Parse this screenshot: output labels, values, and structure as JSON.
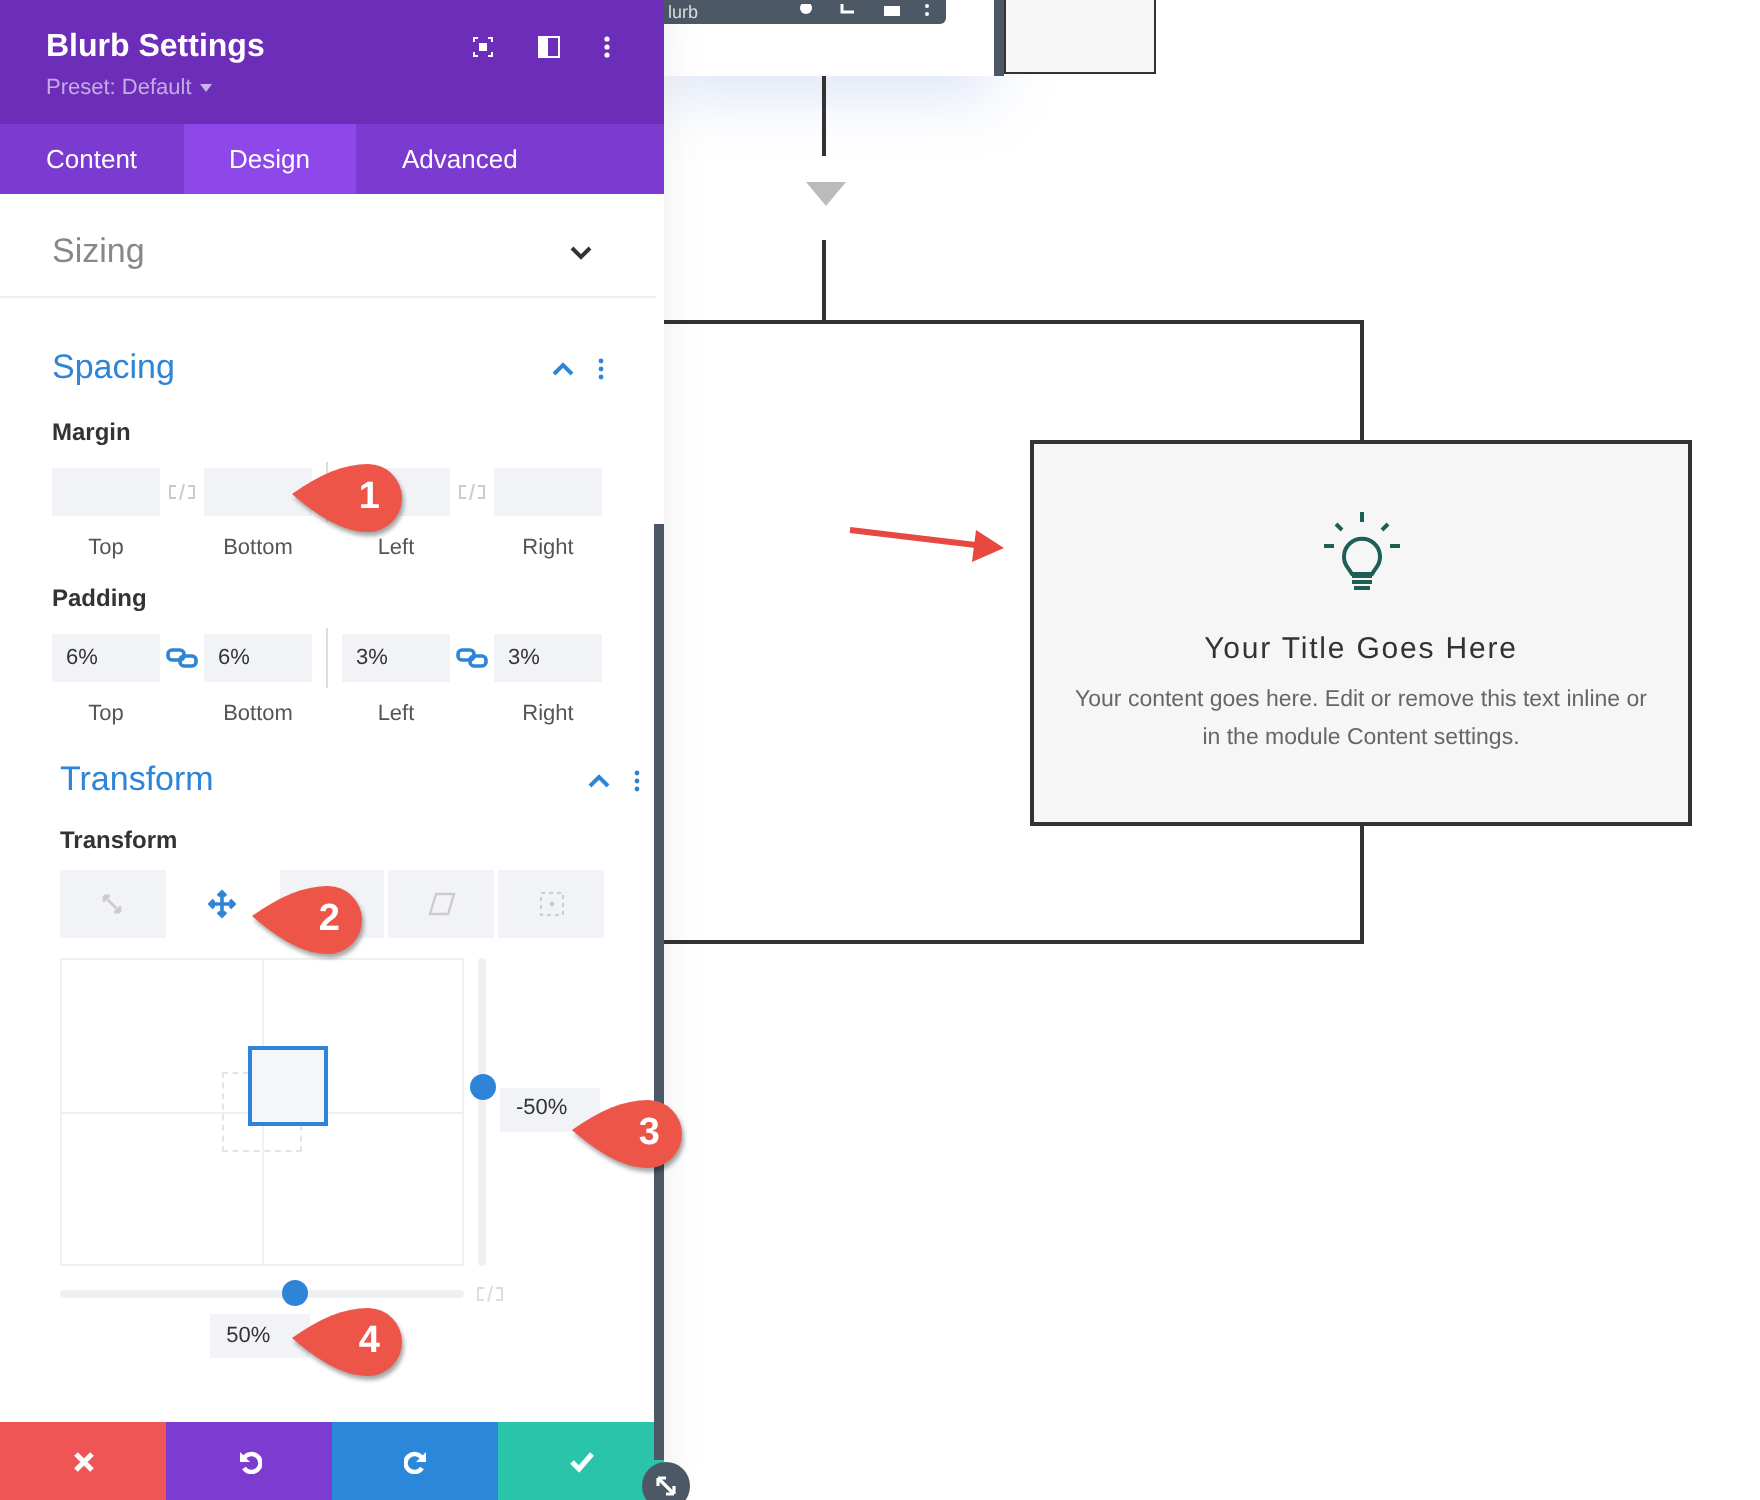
{
  "canvas": {
    "toolbar_label": "lurb",
    "blurb": {
      "title": "Your Title Goes Here",
      "text": "Your content goes here. Edit or remove this text inline or in the module Content settings."
    }
  },
  "panel": {
    "title": "Blurb Settings",
    "preset": "Preset: Default",
    "tabs": [
      {
        "label": "Content",
        "selected": false
      },
      {
        "label": "Design",
        "selected": true
      },
      {
        "label": "Advanced",
        "selected": false
      }
    ],
    "sizing": {
      "title": "Sizing",
      "expanded": false
    },
    "spacing": {
      "title": "Spacing",
      "expanded": true,
      "groups": [
        {
          "label": "Margin",
          "linked": false,
          "fields": [
            {
              "label": "Top"
            },
            {
              "label": "Bottom"
            },
            {
              "label": "Left"
            },
            {
              "label": "Right"
            }
          ]
        },
        {
          "label": "Padding",
          "linked": true,
          "fields": [
            {
              "label": "Top",
              "value": "6%"
            },
            {
              "label": "Bottom",
              "value": "6%"
            },
            {
              "label": "Left",
              "value": "3%"
            },
            {
              "label": "Right",
              "value": "3%"
            }
          ]
        }
      ]
    },
    "transform": {
      "title": "Transform",
      "expanded": true,
      "label": "Transform",
      "tabs": [
        {
          "kind": "scale",
          "selected": false
        },
        {
          "kind": "translate",
          "selected": true
        },
        {
          "selected": false
        },
        {
          "kind": "skew",
          "selected": false
        },
        {
          "kind": "origin",
          "selected": false
        }
      ],
      "vertical": {
        "level": 0.58,
        "value": "-50%"
      },
      "horizontal": {
        "level": 0.58,
        "value": "50%"
      }
    },
    "footer": [
      {
        "kind": "cancel"
      },
      {
        "kind": "undo"
      },
      {
        "kind": "redo"
      },
      {
        "kind": "save"
      }
    ]
  },
  "callouts": [
    {
      "number": "1"
    },
    {
      "number": "2"
    },
    {
      "number": "3"
    },
    {
      "number": "4"
    }
  ]
}
